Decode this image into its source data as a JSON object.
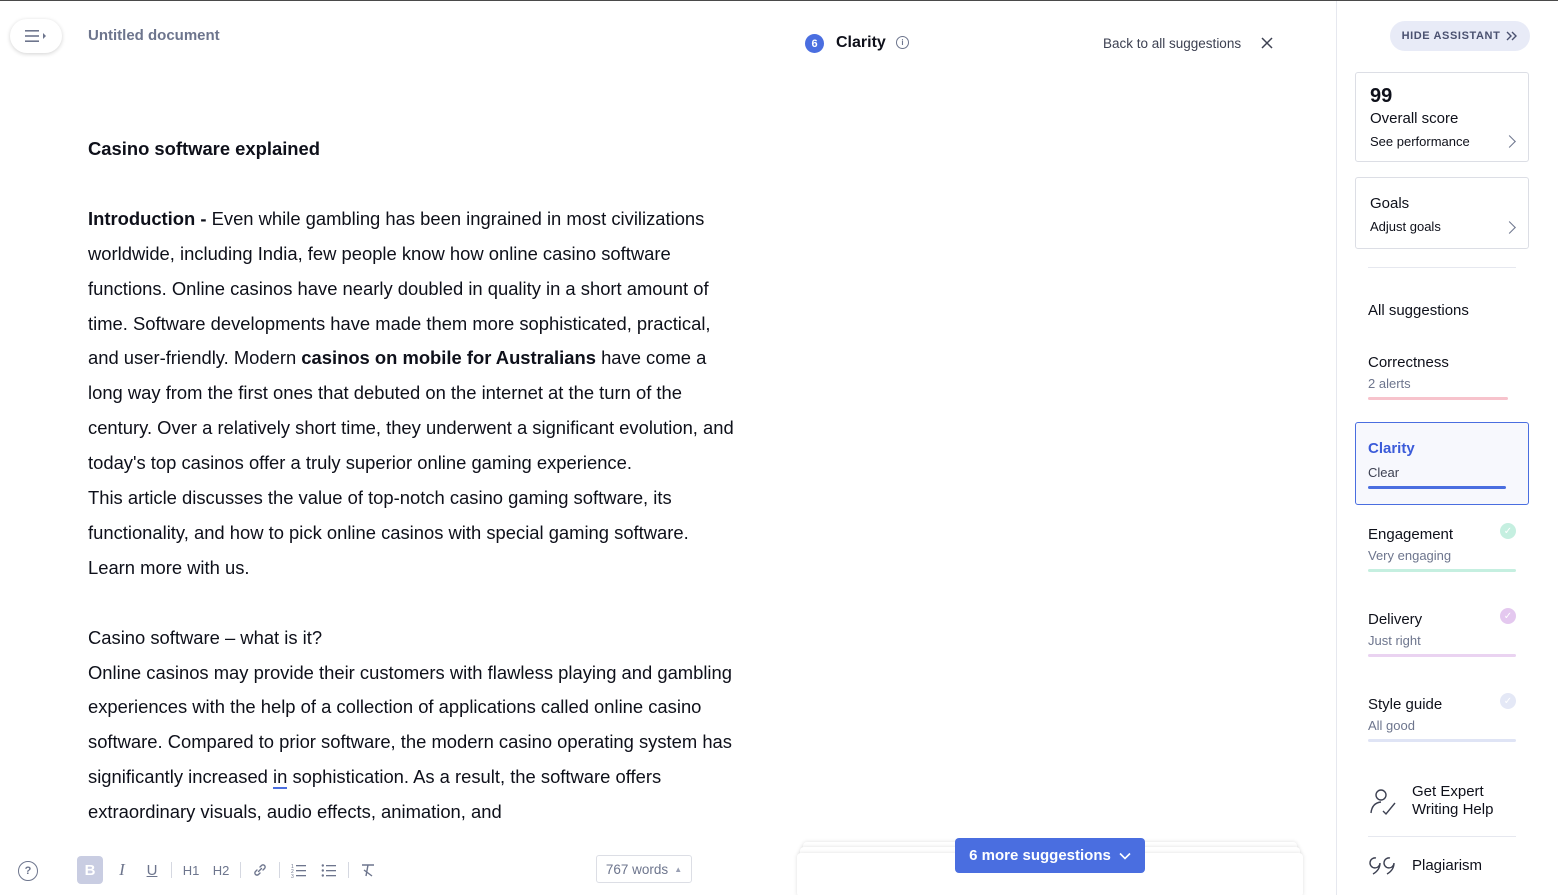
{
  "document": {
    "title": "Untitled document",
    "heading": "Casino software explained",
    "intro_label": "Introduction -",
    "intro_text_1": " Even while gambling has been ingrained in most civilizations worldwide, including India, few people know how online casino software functions. Online casinos have nearly doubled in quality in a short amount of time. Software developments have made them more sophisticated, practical, and user-friendly. Modern ",
    "intro_bold": "casinos on mobile for Australians",
    "intro_text_2": " have come a long way from the first ones that debuted on the internet at the turn of the century. Over a relatively short time, they underwent a significant evolution, and today's top casinos offer a truly superior online gaming experience.",
    "paragraph_2": "This article discusses the value of top-notch casino gaming software, its functionality, and how to pick online casinos with special gaming software. Learn more with us.",
    "subheading": "Casino software – what is it?",
    "paragraph_3a": "Online casinos may provide their customers with flawless playing and gambling experiences with the help of a collection of applications called online casino software. Compared to prior software, the modern casino operating system has significantly increased ",
    "paragraph_3_flagged": "in",
    "paragraph_3b": " sophistication. As a result, the software offers extraordinary visuals, audio effects, animation, and"
  },
  "toolbar": {
    "bold": "B",
    "italic": "I",
    "underline": "U",
    "h1": "H1",
    "h2": "H2",
    "word_count": "767 words"
  },
  "header": {
    "category_count": "6",
    "category_title": "Clarity",
    "back_link": "Back to all suggestions"
  },
  "more_suggestions": {
    "label": "6 more suggestions"
  },
  "sidebar": {
    "hide_button": "HIDE ASSISTANT",
    "score_value": "99",
    "score_label": "Overall score",
    "score_link": "See performance",
    "goals_title": "Goals",
    "goals_link": "Adjust goals",
    "all_suggestions": "All suggestions",
    "categories": [
      {
        "name": "Correctness",
        "status": "2 alerts",
        "color": "#f7c3cc"
      },
      {
        "name": "Clarity",
        "status": "Clear",
        "color": "#4a6ee0"
      },
      {
        "name": "Engagement",
        "status": "Very engaging",
        "color": "#c5efe0"
      },
      {
        "name": "Delivery",
        "status": "Just right",
        "color": "#ead3f1"
      },
      {
        "name": "Style guide",
        "status": "All good",
        "color": "#dfe4f5"
      }
    ],
    "expert_help": "Get Expert\nWriting Help",
    "plagiarism": "Plagiarism"
  },
  "colors": {
    "accent": "#4a6ee0",
    "engagement_check": "#c5efe0",
    "delivery_check": "#e4c8ef",
    "style_check": "#e4e8f6"
  },
  "icons": [
    "menu-icon",
    "info-icon",
    "close-icon",
    "double-chevron-right-icon",
    "chevron-right-icon",
    "check-icon",
    "expert-icon",
    "quote-icon",
    "link-icon",
    "ordered-list-icon",
    "bullet-list-icon",
    "clear-format-icon",
    "help-icon"
  ]
}
